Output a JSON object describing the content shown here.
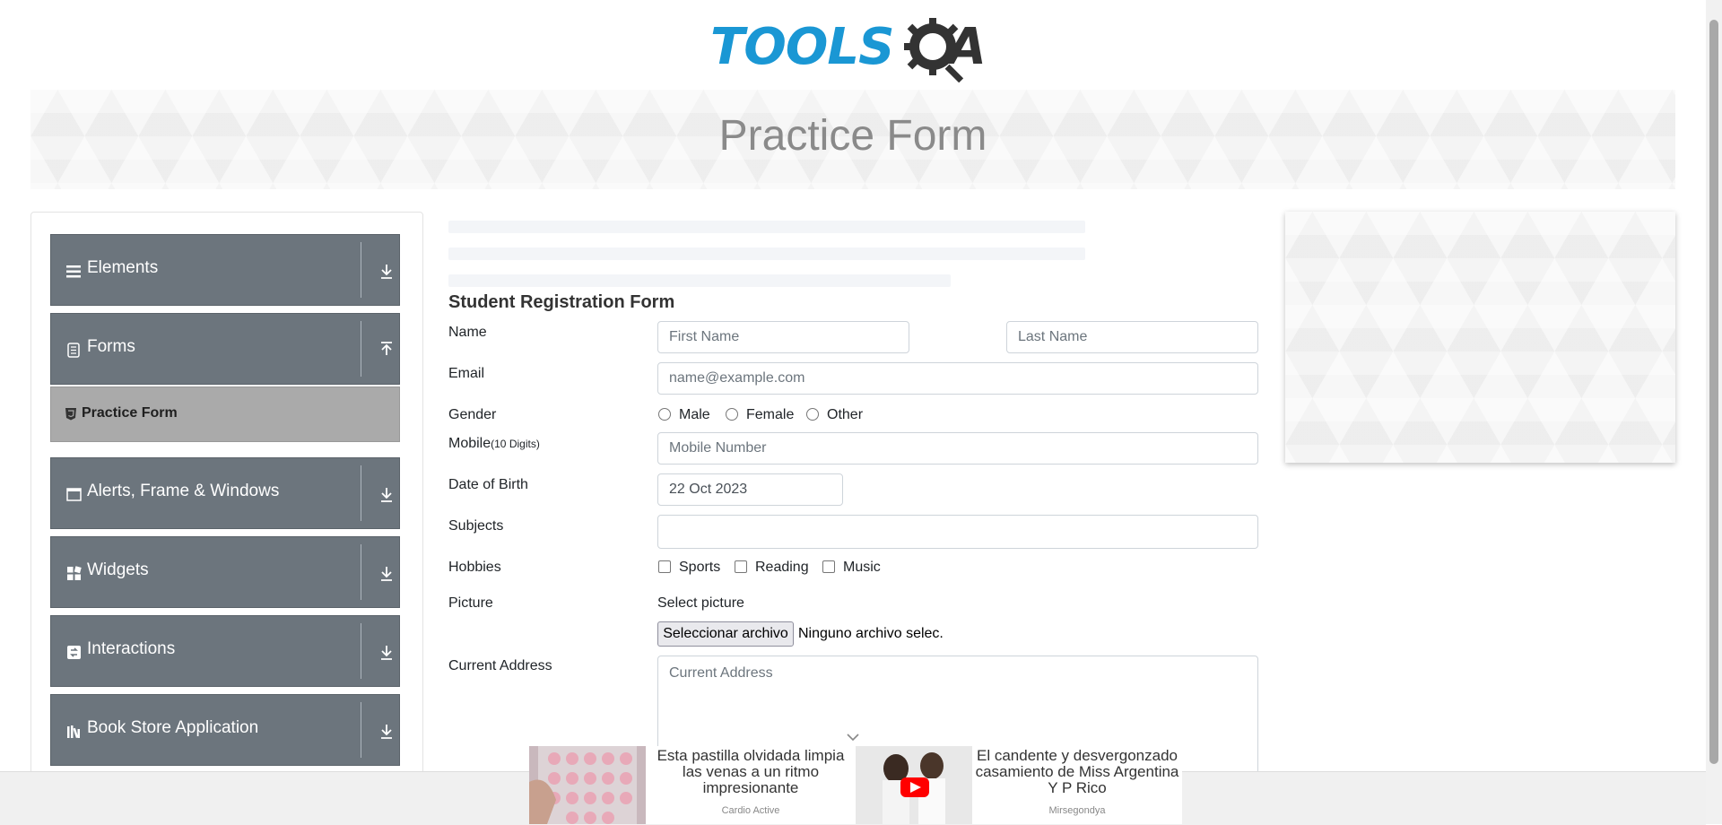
{
  "logo": {
    "text_tools": "TOOLS",
    "text_qa": "A",
    "brand_blue": "#1a97d4",
    "brand_dark": "#333333"
  },
  "banner": {
    "title": "Practice Form"
  },
  "sidebar": {
    "groups": [
      {
        "label": "Elements",
        "icon": "hamburger-icon",
        "arrow": "download-arrow-icon"
      },
      {
        "label": "Forms",
        "icon": "form-icon",
        "arrow": "upload-arrow-icon"
      },
      {
        "label": "Alerts, Frame & Windows",
        "icon": "window-icon",
        "arrow": "download-arrow-icon"
      },
      {
        "label": "Widgets",
        "icon": "widgets-icon",
        "arrow": "download-arrow-icon"
      },
      {
        "label": "Interactions",
        "icon": "interactions-icon",
        "arrow": "download-arrow-icon"
      },
      {
        "label": "Book Store Application",
        "icon": "book-icon",
        "arrow": "download-arrow-icon"
      }
    ],
    "active_item": {
      "label": "Practice Form",
      "icon": "html5-icon"
    },
    "group_color": "#6c757d",
    "active_color": "#aaaaaa"
  },
  "form": {
    "title": "Student Registration Form",
    "name_label": "Name",
    "first_name_placeholder": "First Name",
    "last_name_placeholder": "Last Name",
    "email_label": "Email",
    "email_placeholder": "name@example.com",
    "gender_label": "Gender",
    "gender_options": [
      "Male",
      "Female",
      "Other"
    ],
    "mobile_label": "Mobile",
    "mobile_hint": "(10 Digits)",
    "mobile_placeholder": "Mobile Number",
    "dob_label": "Date of Birth",
    "dob_value": "22 Oct 2023",
    "subjects_label": "Subjects",
    "hobbies_label": "Hobbies",
    "hobbies_options": [
      "Sports",
      "Reading",
      "Music"
    ],
    "picture_label": "Picture",
    "select_picture": "Select picture",
    "file_button": "Seleccionar archivo",
    "file_status": "Ninguno archivo selec.",
    "address_label": "Current Address",
    "address_placeholder": "Current Address"
  },
  "ads": [
    {
      "text": "Esta pastilla olvidada limpia las venas a un ritmo impresionante",
      "source": "Cardio Active"
    },
    {
      "text": "El candente y desvergonzado casamiento de Miss Argentina Y P Rico",
      "source": "Mirsegondya"
    }
  ]
}
